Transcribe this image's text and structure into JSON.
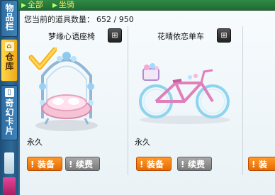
{
  "sidebar": {
    "tabs": [
      {
        "label": "物品栏",
        "icon": "bag-icon",
        "active": false
      },
      {
        "label": "仓库",
        "icon": "house-icon",
        "active": true
      },
      {
        "label": "奇幻卡片",
        "icon": "card-icon",
        "active": false
      }
    ]
  },
  "filter": {
    "crumb1": "全部",
    "crumb2": "坐骑"
  },
  "inventory": {
    "count_label": "您当前的道具数量：",
    "count_value": "652 / 950"
  },
  "items": [
    {
      "name": "梦缘心语座椅",
      "duration": "永久",
      "equip_label": "装备",
      "renew_label": "续费",
      "equipped": true
    },
    {
      "name": "花晴依恋单车",
      "duration": "永久",
      "equip_label": "装备",
      "renew_label": "续费",
      "equipped": false
    },
    {
      "name": "",
      "duration": "",
      "equip_label": "装",
      "renew_label": "",
      "equipped": false
    }
  ],
  "colors": {
    "equip_button": "#e86a00",
    "renew_button": "#7a7a7a",
    "active_tab": "#f0a81a",
    "panel_bg": "#f7fbfd"
  }
}
